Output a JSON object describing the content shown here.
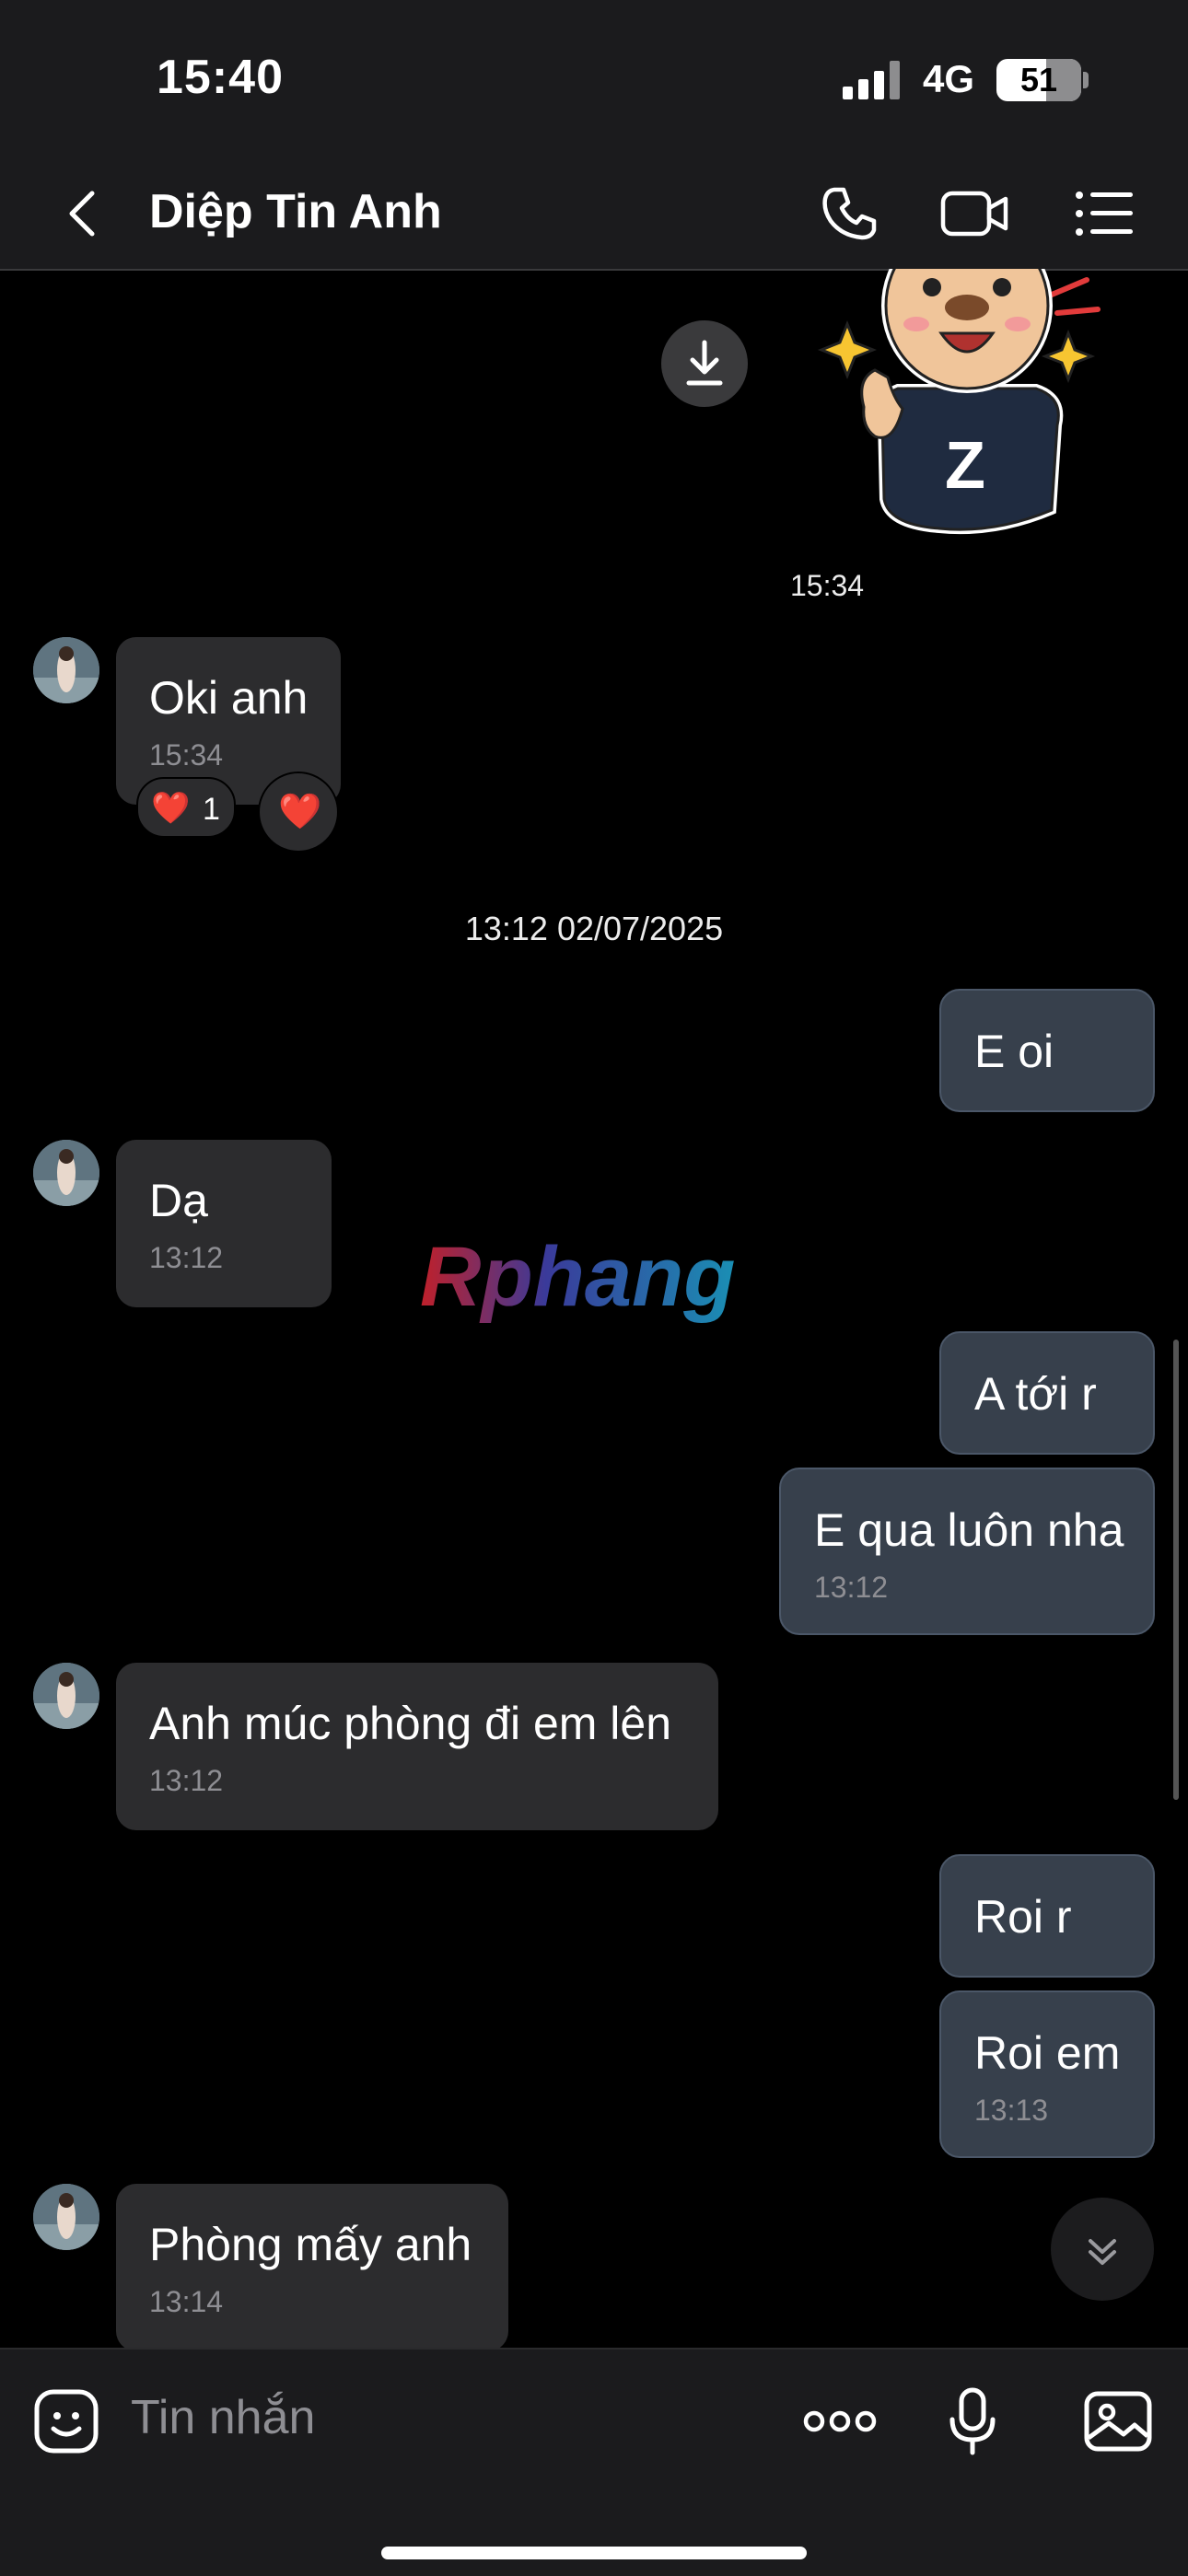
{
  "status_bar": {
    "time": "15:40",
    "network": "4G",
    "battery": "51"
  },
  "header": {
    "back_icon": "chevron-left-icon",
    "contact_name": "Diệp Tin Anh",
    "icons": [
      "phone-icon",
      "video-camera-icon",
      "list-menu-icon"
    ]
  },
  "messages": {
    "sticker": {
      "download_icon": "download-icon",
      "sticker_letter": "Z",
      "time": "15:34"
    },
    "m1": {
      "text": "Oki anh",
      "time": "15:34",
      "reaction": "❤️",
      "reaction_count": "1",
      "react_button": "❤️"
    },
    "date_separator": "13:12 02/07/2025",
    "m2": {
      "text": "E oi"
    },
    "m3": {
      "text": "Dạ",
      "time": "13:12"
    },
    "watermark": "Rphang",
    "m4": {
      "text": "A tới r"
    },
    "m5": {
      "text": "E qua luôn nha",
      "time": "13:12"
    },
    "m6": {
      "text": "Anh múc phòng đi em lên",
      "time": "13:12"
    },
    "m7": {
      "text": "Roi r"
    },
    "m8": {
      "text": "Roi em",
      "time": "13:13"
    },
    "m9": {
      "text": "Phòng mấy anh",
      "time": "13:14"
    }
  },
  "composer": {
    "placeholder": "Tin nhắn",
    "icons": [
      "emoji-icon",
      "more-options-icon",
      "microphone-icon",
      "image-icon"
    ]
  },
  "colors": {
    "background": "#000000",
    "bar": "#1b1b1d",
    "incoming_bubble": "#2c2c2e",
    "outgoing_bubble": "#37404c",
    "timestamp": "#8e8e93"
  }
}
